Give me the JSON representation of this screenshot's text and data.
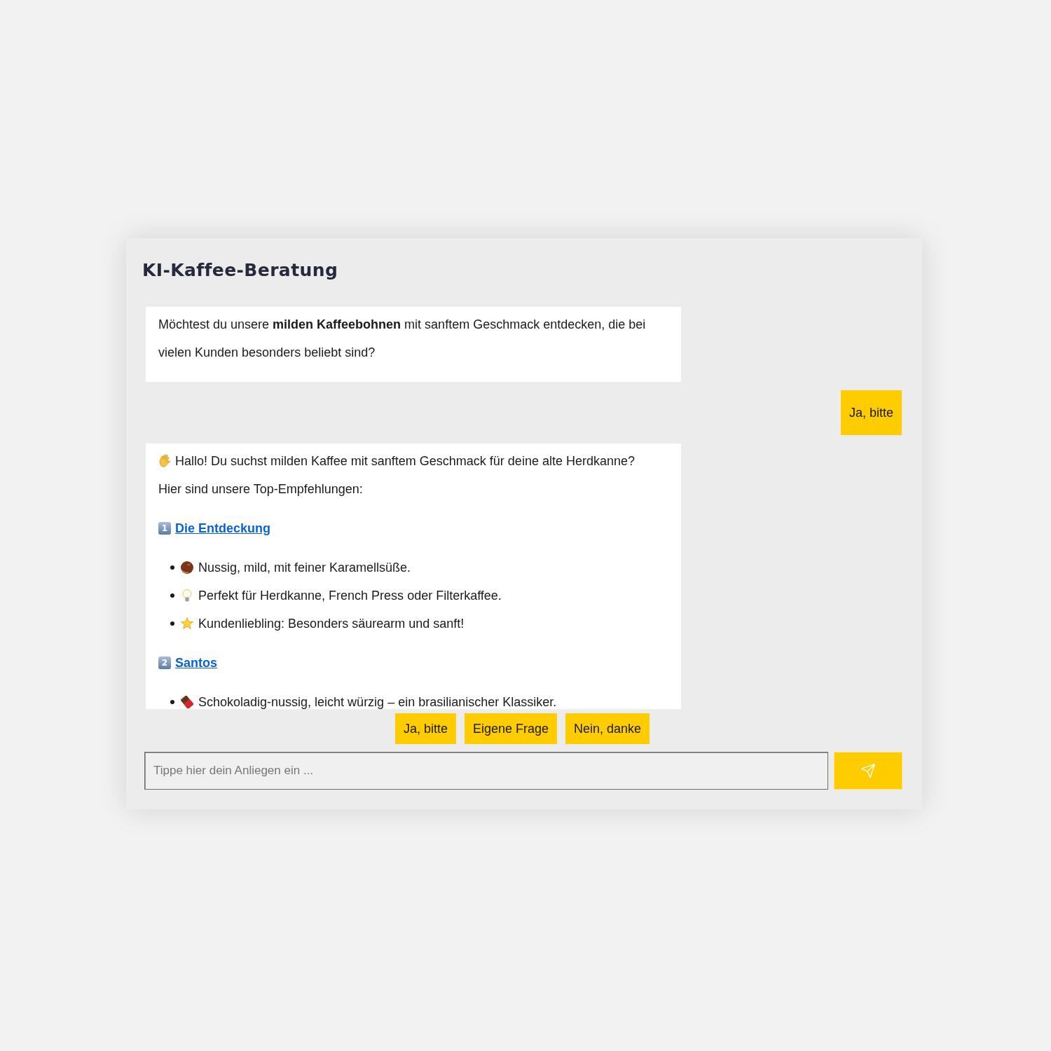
{
  "title": "KI-Kaffee-Beratung",
  "messages": [
    {
      "kind": "bot",
      "blocks": [
        {
          "kind": "paragraph",
          "text": "Möchtest du unsere **milden Kaffeebohnen** mit sanftem Geschmack entdecken, die bei vielen Kunden besonders beliebt sind?"
        }
      ]
    },
    {
      "kind": "user",
      "text": "Ja, bitte"
    },
    {
      "kind": "bot",
      "blocks": [
        {
          "kind": "greeting",
          "text": "Hallo! Du suchst milden Kaffee mit sanftem Geschmack für deine alte Herdkanne?"
        },
        {
          "kind": "paragraph",
          "text": "Hier sind unsere Top-Empfehlungen:"
        },
        {
          "kind": "product",
          "number": "1",
          "name": "Die Entdeckung",
          "points": [
            {
              "kind": "nut",
              "text": "Nussig, mild, mit feiner Karamellsüße."
            },
            {
              "kind": "bulb",
              "text": "Perfekt für Herdkanne, French Press oder Filterkaffee."
            },
            {
              "kind": "star",
              "text": "Kundenliebling: Besonders säurearm und sanft!"
            }
          ]
        },
        {
          "kind": "product",
          "number": "2",
          "name": "Santos",
          "points": [
            {
              "kind": "chocolate",
              "text": "Schokoladig-nussig, leicht würzig – ein brasilianischer Klassiker."
            }
          ]
        }
      ]
    }
  ],
  "quick_replies": [
    "Ja, bitte",
    "Eigene Frage",
    "Nein, danke"
  ],
  "input": {
    "placeholder": "Tippe hier dein Anliegen ein ..."
  }
}
